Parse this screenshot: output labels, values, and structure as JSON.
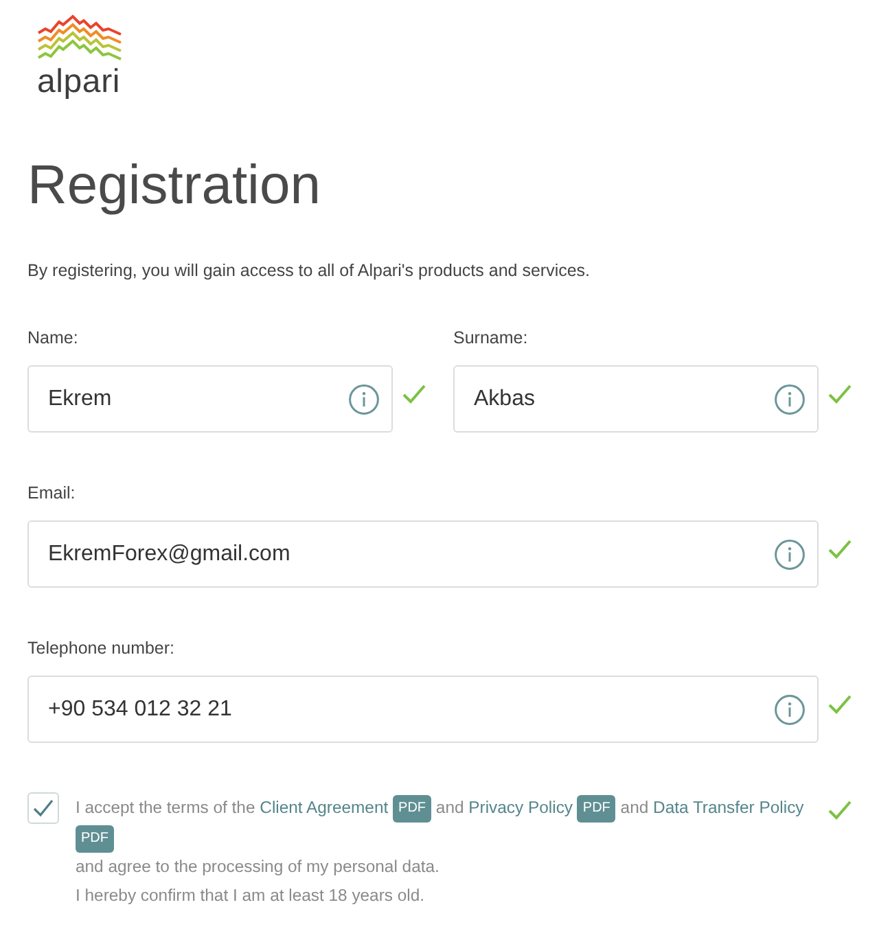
{
  "logo": {
    "text": "alpari"
  },
  "title": "Registration",
  "intro": "By registering, you will gain access to all of Alpari's products and services.",
  "form": {
    "rows": [
      {
        "fields": [
          {
            "label": "Name:",
            "value": "Ekrem",
            "valid": true
          },
          {
            "label": "Surname:",
            "value": "Akbas",
            "valid": true
          }
        ]
      },
      {
        "fields": [
          {
            "label": "Email:",
            "value": "EkremForex@gmail.com",
            "valid": true
          }
        ]
      },
      {
        "fields": [
          {
            "label": "Telephone number:",
            "value": "+90 534 012 32 21",
            "valid": true
          }
        ]
      }
    ]
  },
  "consent": {
    "checked": true,
    "valid": true,
    "parts": [
      {
        "kind": "text",
        "text": "I accept the terms of the"
      },
      {
        "kind": "link",
        "text": "Client Agreement"
      },
      {
        "kind": "badge",
        "text": "PDF"
      },
      {
        "kind": "text",
        "text": "and"
      },
      {
        "kind": "link",
        "text": "Privacy Policy"
      },
      {
        "kind": "badge",
        "text": "PDF"
      },
      {
        "kind": "text",
        "text": "and"
      },
      {
        "kind": "link",
        "text": "Data Transfer Policy"
      },
      {
        "kind": "badge",
        "text": "PDF"
      }
    ],
    "lines": [
      "and agree to the processing of my personal data.",
      "I hereby confirm that I am at least 18 years old."
    ]
  }
}
